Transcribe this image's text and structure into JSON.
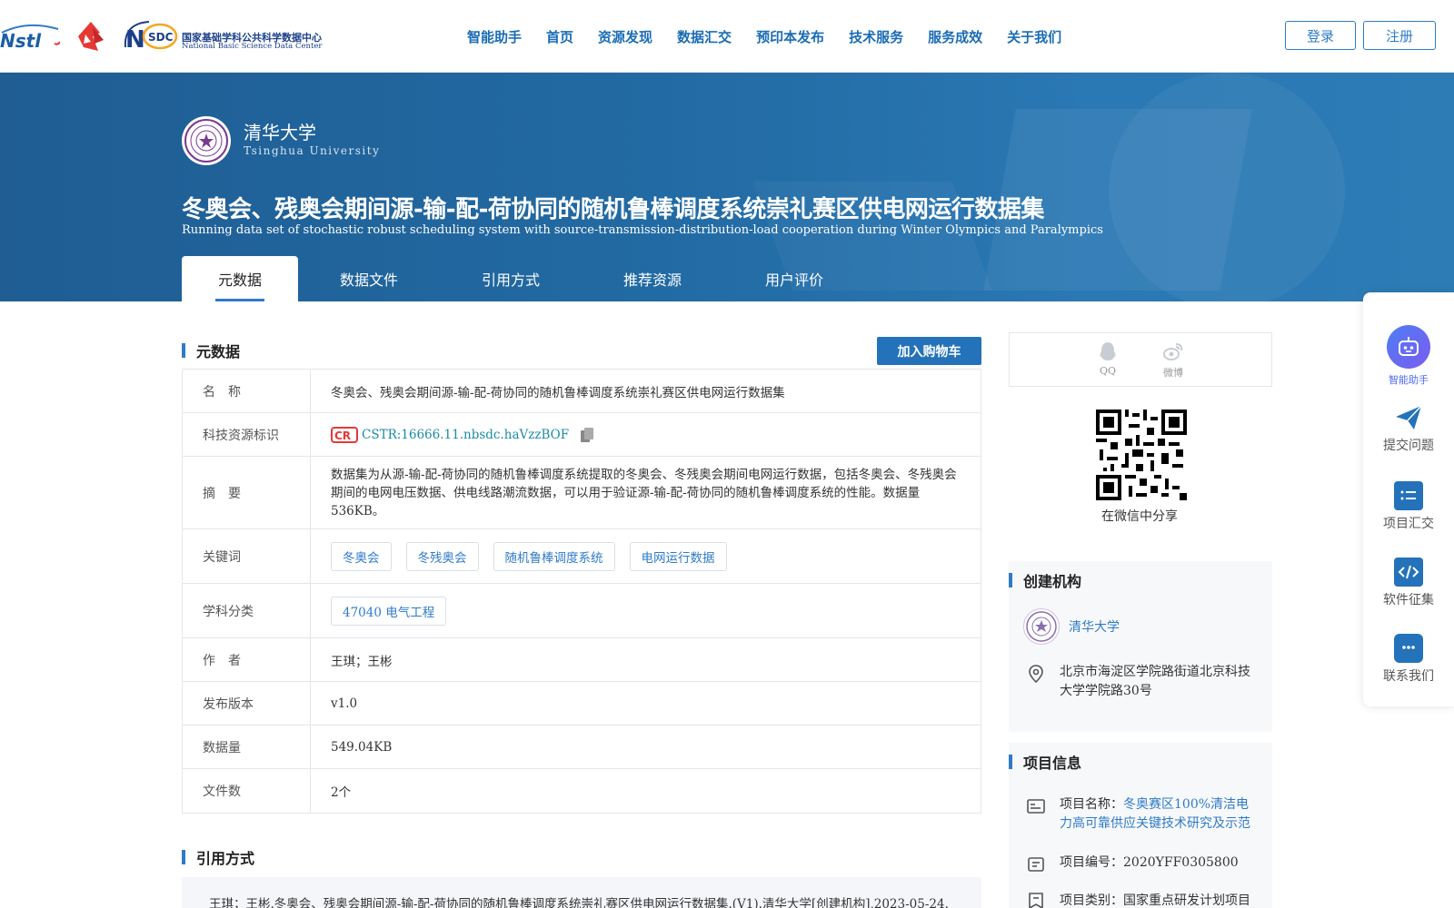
{
  "header": {
    "nsdc_cn": "国家基础学科公共科学数据中心",
    "nsdc_en": "National Basic Science Data Center",
    "nav": [
      "智能助手",
      "首页",
      "资源发现",
      "数据汇交",
      "预印本发布",
      "技术服务",
      "服务成效",
      "关于我们"
    ],
    "login": "登录",
    "register": "注册"
  },
  "hero": {
    "univ_cn": "清华大学",
    "univ_en": "Tsinghua University",
    "title": "冬奥会、残奥会期间源-输-配-荷协同的随机鲁棒调度系统崇礼赛区供电网运行数据集",
    "subtitle": "Running data set of stochastic robust scheduling system with source-transmission-distribution-load cooperation during Winter Olympics and Paralympics",
    "tabs": [
      "元数据",
      "数据文件",
      "引用方式",
      "推荐资源",
      "用户评价"
    ]
  },
  "metadata": {
    "section_title": "元数据",
    "cart_button": "加入购物车",
    "rows": {
      "name_k": "名　称",
      "name_v": "冬奥会、残奥会期间源-输-配-荷协同的随机鲁棒调度系统崇礼赛区供电网运行数据集",
      "cstr_k": "科技资源标识",
      "cstr_v": "CSTR:16666.11.nbsdc.haVzzBOF",
      "abstract_k": "摘　要",
      "abstract_v": "数据集为从源-输-配-荷协同的随机鲁棒调度系统提取的冬奥会、冬残奥会期间电网运行数据，包括冬奥会、冬残奥会期间的电网电压数据、供电线路潮流数据，可以用于验证源-输-配-荷协同的随机鲁棒调度系统的性能。数据量536KB。",
      "keywords_k": "关键词",
      "keywords": [
        "冬奥会",
        "冬残奥会",
        "随机鲁棒调度系统",
        "电网运行数据"
      ],
      "subject_k": "学科分类",
      "subject_v": "47040 电气工程",
      "author_k": "作　者",
      "author_v": "王琪；王彬",
      "version_k": "发布版本",
      "version_v": "v1.0",
      "size_k": "数据量",
      "size_v": "549.04KB",
      "files_k": "文件数",
      "files_v": "2个"
    }
  },
  "citation": {
    "section_title": "引用方式",
    "text": "王琪；王彬.冬奥会、残奥会期间源-输-配-荷协同的随机鲁棒调度系统崇礼赛区供电网运行数据集.(V1).清华大学[创建机构],2023-05-24."
  },
  "sidebar": {
    "share_qq": "QQ",
    "share_weibo": "微博",
    "qr_caption": "在微信中分享",
    "org_title": "创建机构",
    "org_name": "清华大学",
    "org_address": "北京市海淀区学院路街道北京科技大学学院路30号",
    "project_title": "项目信息",
    "project_name_label": "项目名称：",
    "project_name": "冬奥赛区100%清洁电力高可靠供应关键技术研究及示范",
    "project_no": "项目编号：2020YFF0305800",
    "project_type": "项目类别：国家重点研发计划项目"
  },
  "float_toolbar": [
    "智能助手",
    "提交问题",
    "项目汇交",
    "软件征集",
    "联系我们"
  ],
  "colors": {
    "primary": "#2472ba",
    "hero": "#226aa3",
    "link": "#2f7bc7"
  }
}
